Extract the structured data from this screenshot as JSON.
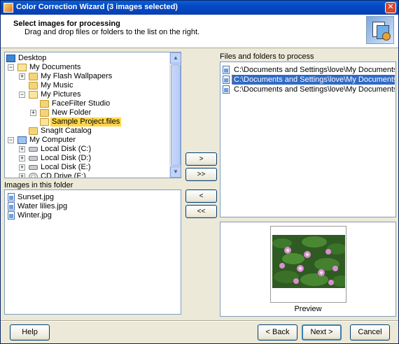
{
  "window": {
    "title": "Color Correction Wizard (3 images selected)",
    "close_glyph": "✕"
  },
  "header": {
    "title": "Select images for processing",
    "subtitle": "Drag and drop files or folders to the list on the right.",
    "icon": "wizard-images-icon"
  },
  "tree": {
    "items": [
      {
        "label": "Desktop",
        "icon": "desktop-icon"
      },
      {
        "label": "My Documents",
        "icon": "documents-folder-icon",
        "expander": "−"
      },
      {
        "label": "My Flash Wallpapers",
        "icon": "folder-icon",
        "expander": "+"
      },
      {
        "label": "My Music",
        "icon": "folder-icon"
      },
      {
        "label": "My Pictures",
        "icon": "pictures-folder-icon",
        "expander": "−"
      },
      {
        "label": "FaceFilter Studio",
        "icon": "folder-icon"
      },
      {
        "label": "New Folder",
        "icon": "folder-icon",
        "expander": "+"
      },
      {
        "label": "Sample Project.files",
        "icon": "folder-open-icon",
        "selected": true
      },
      {
        "label": "SnagIt Catalog",
        "icon": "folder-icon"
      },
      {
        "label": "My Computer",
        "icon": "computer-icon",
        "expander": "−"
      },
      {
        "label": "Local Disk (C:)",
        "icon": "drive-icon",
        "expander": "+"
      },
      {
        "label": "Local Disk (D:)",
        "icon": "drive-icon",
        "expander": "+"
      },
      {
        "label": "Local Disk (E:)",
        "icon": "drive-icon",
        "expander": "+"
      },
      {
        "label": "CD Drive (F:)",
        "icon": "cd-drive-icon",
        "expander": "+"
      }
    ]
  },
  "images_label": "Images in this folder",
  "images": [
    "Sunset.jpg",
    "Water lilies.jpg",
    "Winter.jpg"
  ],
  "transfer_buttons": {
    "add": ">",
    "add_all": ">>",
    "remove": "<",
    "remove_all": "<<"
  },
  "process": {
    "label": "Files and folders to process",
    "items": [
      {
        "path": "C:\\Documents and Settings\\love\\My Documents\\My Pic...",
        "selected": false
      },
      {
        "path": "C:\\Documents and Settings\\love\\My Documents\\My Pic...",
        "selected": true
      },
      {
        "path": "C:\\Documents and Settings\\love\\My Documents\\My Pic...",
        "selected": false
      }
    ]
  },
  "preview": {
    "label": "Preview"
  },
  "footer": {
    "help": "Help",
    "back": "< Back",
    "next": "Next >",
    "cancel": "Cancel"
  },
  "colors": {
    "title_bar": "#0a5fd8",
    "selection": "#316ac5",
    "tree_selection": "#ffd64a",
    "face": "#ece9d8"
  }
}
